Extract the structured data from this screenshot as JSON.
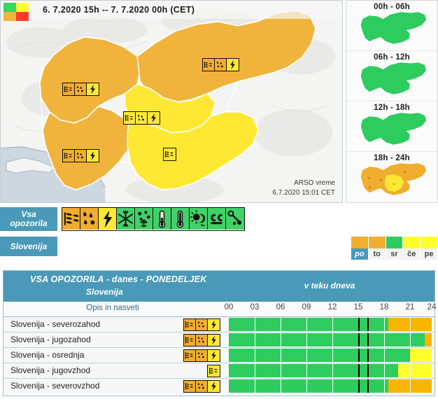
{
  "map": {
    "title": "6. 7.2020 15h  --  7. 7.2020 00h    (CET)",
    "attribution_line1": "ARSO vreme",
    "attribution_line2": "6.7.2020  15:01 CET",
    "legend_swatch": {
      "green": "#3ad45f",
      "yellow": "#ffff33",
      "orange": "#f0b43c",
      "red": "#ff3b30"
    },
    "regions": [
      {
        "name": "severozahod",
        "color": "#f0b43c",
        "icons": [
          "wind-icon",
          "rain-icon",
          "thunder-icon"
        ]
      },
      {
        "name": "severovzhod",
        "color": "#f0b43c",
        "icons": [
          "wind-icon",
          "rain-icon",
          "thunder-icon"
        ]
      },
      {
        "name": "osrednja",
        "color": "#ffe834",
        "icons": [
          "wind-icon",
          "rain-icon",
          "thunder-icon"
        ]
      },
      {
        "name": "jugozahod",
        "color": "#f0b43c",
        "icons": [
          "wind-icon",
          "rain-icon",
          "thunder-icon"
        ]
      },
      {
        "name": "jugovzhod",
        "color": "#ffe834",
        "icons": [
          "wind-icon"
        ]
      }
    ]
  },
  "strip": {
    "periods": [
      {
        "label": "00h - 06h",
        "level": "green"
      },
      {
        "label": "06h - 12h",
        "level": "green"
      },
      {
        "label": "12h - 18h",
        "level": "green"
      },
      {
        "label": "18h - 24h",
        "level": "orange"
      }
    ]
  },
  "legend": {
    "all_warnings_label": "Vsa\nopozorila",
    "all_warnings_line1": "Vsa",
    "all_warnings_line2": "opozorila",
    "country_label": "Slovenija",
    "icons": [
      {
        "name": "wind-icon",
        "level": "orange"
      },
      {
        "name": "rain-icon",
        "level": "orange"
      },
      {
        "name": "thunder-icon",
        "level": "yellow"
      },
      {
        "name": "snow-icon",
        "level": "green"
      },
      {
        "name": "ice-icon",
        "level": "green"
      },
      {
        "name": "low-temperature-icon",
        "level": "green"
      },
      {
        "name": "high-temperature-icon",
        "level": "green"
      },
      {
        "name": "uv-sun-icon",
        "level": "green"
      },
      {
        "name": "fog-icon",
        "level": "green"
      },
      {
        "name": "air-pollution-icon",
        "level": "green"
      }
    ]
  },
  "day_selector": {
    "days": [
      {
        "label": "po",
        "level": "orange",
        "selected": true
      },
      {
        "label": "to",
        "level": "orange",
        "selected": false
      },
      {
        "label": "sr",
        "level": "green",
        "selected": false
      },
      {
        "label": "če",
        "level": "yellow",
        "selected": false
      },
      {
        "label": "pe",
        "level": "yellow",
        "selected": false
      }
    ]
  },
  "table": {
    "title": "VSA OPOZORILA - danes - PONEDELJEK",
    "subtitle": "Slovenija",
    "right_header": "v teku dneva",
    "description_header": "Opis in nasveti",
    "time_ticks": [
      "00",
      "03",
      "06",
      "09",
      "12",
      "15",
      "18",
      "21",
      "24"
    ],
    "now_markers": [
      15,
      16
    ],
    "rows": [
      {
        "name": "Slovenija - severozahod",
        "icons": [
          {
            "name": "wind-icon",
            "level": "orange"
          },
          {
            "name": "rain-icon",
            "level": "orange"
          },
          {
            "name": "thunder-icon",
            "level": "yellow"
          }
        ],
        "segments": [
          {
            "from": 0,
            "to": 18,
            "level": "green"
          },
          {
            "from": 18,
            "to": 24,
            "level": "orange"
          }
        ]
      },
      {
        "name": "Slovenija - jugozahod",
        "icons": [
          {
            "name": "wind-icon",
            "level": "orange"
          },
          {
            "name": "rain-icon",
            "level": "orange"
          },
          {
            "name": "thunder-icon",
            "level": "yellow"
          }
        ],
        "segments": [
          {
            "from": 0,
            "to": 23,
            "level": "green"
          },
          {
            "from": 23,
            "to": 24,
            "level": "orange"
          }
        ]
      },
      {
        "name": "Slovenija - osrednja",
        "icons": [
          {
            "name": "wind-icon",
            "level": "orange"
          },
          {
            "name": "rain-icon",
            "level": "orange"
          },
          {
            "name": "thunder-icon",
            "level": "yellow"
          }
        ],
        "segments": [
          {
            "from": 0,
            "to": 21,
            "level": "green"
          },
          {
            "from": 21,
            "to": 24,
            "level": "yellow"
          }
        ]
      },
      {
        "name": "Slovenija - jugovzhod",
        "icons": [
          {
            "name": "wind-icon",
            "level": "yellow"
          }
        ],
        "segments": [
          {
            "from": 0,
            "to": 20,
            "level": "green"
          },
          {
            "from": 20,
            "to": 24,
            "level": "yellow"
          }
        ]
      },
      {
        "name": "Slovenija - severovzhod",
        "icons": [
          {
            "name": "wind-icon",
            "level": "orange"
          },
          {
            "name": "rain-icon",
            "level": "orange"
          },
          {
            "name": "thunder-icon",
            "level": "yellow"
          }
        ],
        "segments": [
          {
            "from": 0,
            "to": 18,
            "level": "green"
          },
          {
            "from": 18,
            "to": 24,
            "level": "orange"
          }
        ]
      }
    ]
  }
}
